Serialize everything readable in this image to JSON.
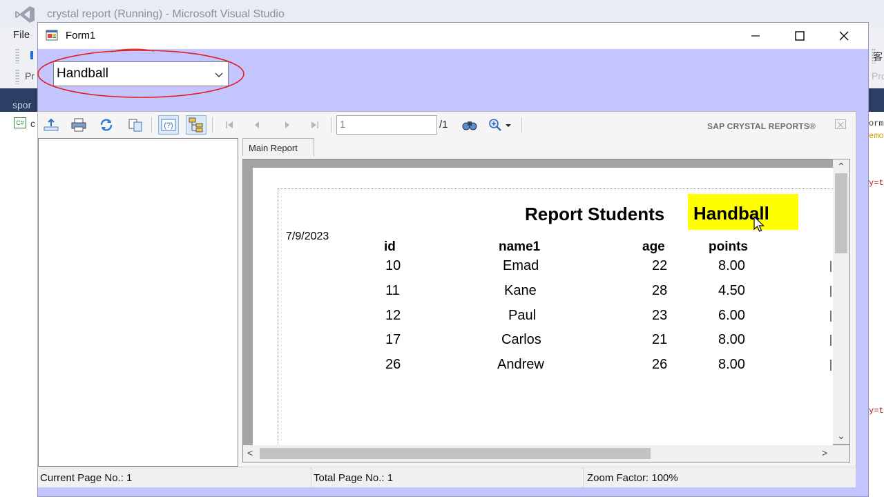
{
  "vs": {
    "title": "crystal report (Running) - Microsoft Visual Studio",
    "menu_file": "File",
    "toolbar_p": "Pr",
    "toolbar_right_1": "客",
    "toolbar_right_2": "Pro",
    "doc_tab": "spor",
    "code_1": "orm",
    "code_2": "emo",
    "code_3": "y=t",
    "code_4": "y=t"
  },
  "form": {
    "title": "Form1",
    "combo_value": "Handball"
  },
  "viewer": {
    "page_current": "1",
    "page_total": "/1",
    "brand": "SAP CRYSTAL REPORTS®",
    "main_tab": "Main Report",
    "status": {
      "current_page": "Current Page No.: 1",
      "total_page": "Total Page No.: 1",
      "zoom": "Zoom Factor: 100%"
    }
  },
  "report": {
    "title": "Report Students",
    "sport": "Handball",
    "date": "7/9/2023",
    "columns": [
      "id",
      "name1",
      "age",
      "points"
    ],
    "rows": [
      [
        "10",
        "Emad",
        "22",
        "8.00"
      ],
      [
        "11",
        "Kane",
        "28",
        "4.50"
      ],
      [
        "12",
        "Paul",
        "23",
        "6.00"
      ],
      [
        "17",
        "Carlos",
        "21",
        "8.00"
      ],
      [
        "26",
        "Andrew",
        "26",
        "8.00"
      ]
    ]
  },
  "colors": {
    "form_background": "#c4c4ff",
    "highlight": "#ffff00",
    "ellipse": "#e0201e",
    "vs_docbar": "#2b3e63"
  },
  "icons": [
    "visual-studio-logo",
    "form-app-icon",
    "minimize-icon",
    "maximize-icon",
    "close-icon",
    "chevron-down-icon",
    "export-icon",
    "print-icon",
    "refresh-icon",
    "copy-icon",
    "help-icon",
    "group-tree-icon",
    "first-page-icon",
    "previous-page-icon",
    "next-page-icon",
    "last-page-icon",
    "find-icon",
    "zoom-icon",
    "mouse-cursor-icon"
  ]
}
